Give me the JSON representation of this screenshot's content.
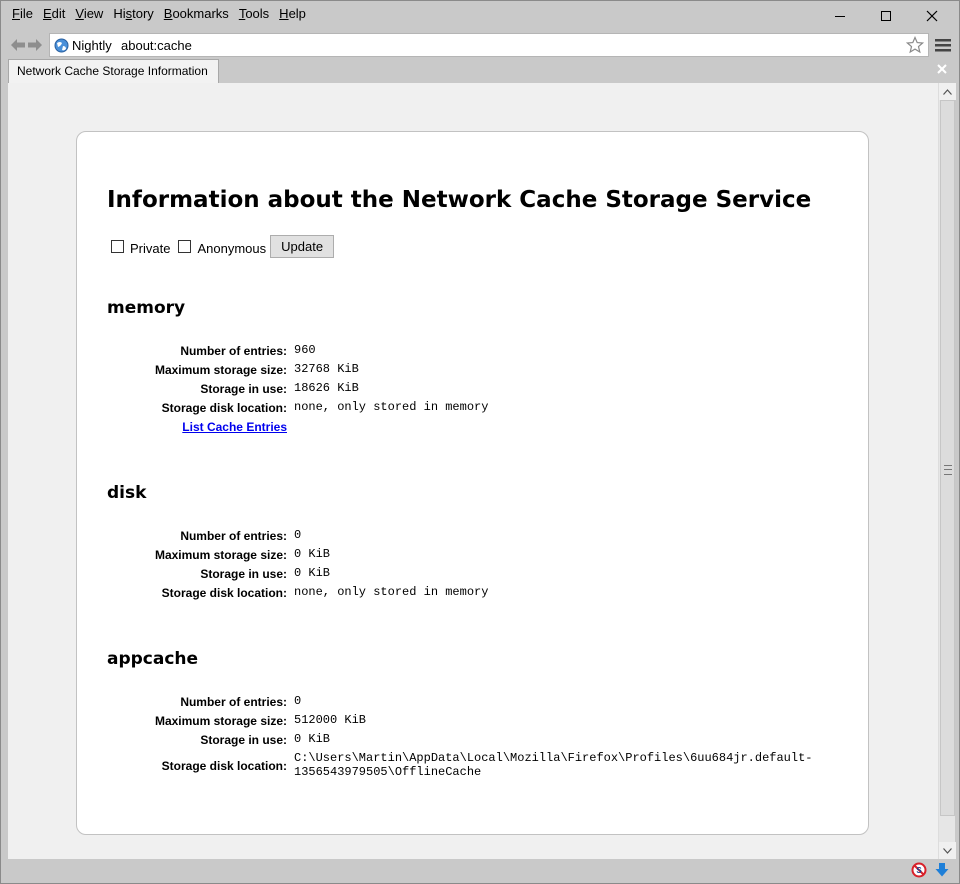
{
  "menu": {
    "items": [
      {
        "acc": "F",
        "rest": "ile"
      },
      {
        "acc": "E",
        "rest": "dit"
      },
      {
        "acc": "V",
        "rest": "iew"
      },
      {
        "pre": "Hi",
        "acc": "s",
        "rest": "tory"
      },
      {
        "acc": "B",
        "rest": "ookmarks"
      },
      {
        "acc": "T",
        "rest": "ools"
      },
      {
        "acc": "H",
        "rest": "elp"
      }
    ]
  },
  "nav": {
    "identity_label": "Nightly",
    "url": "about:cache"
  },
  "tab": {
    "title": "Network Cache Storage Information"
  },
  "page": {
    "title": "Information about the Network Cache Storage Service",
    "private_label": "Private",
    "anonymous_label": "Anonymous",
    "update_label": "Update"
  },
  "sections": {
    "memory": {
      "title": "memory",
      "entries_label": "Number of entries:",
      "entries": "960",
      "max_label": "Maximum storage size:",
      "max": "32768 KiB",
      "inuse_label": "Storage in use:",
      "inuse": "18626 KiB",
      "location_label": "Storage disk location:",
      "location": "none, only stored in memory",
      "list_link": "List Cache Entries"
    },
    "disk": {
      "title": "disk",
      "entries_label": "Number of entries:",
      "entries": "0",
      "max_label": "Maximum storage size:",
      "max": "0 KiB",
      "inuse_label": "Storage in use:",
      "inuse": "0 KiB",
      "location_label": "Storage disk location:",
      "location": "none, only stored in memory"
    },
    "appcache": {
      "title": "appcache",
      "entries_label": "Number of entries:",
      "entries": "0",
      "max_label": "Maximum storage size:",
      "max": "512000 KiB",
      "inuse_label": "Storage in use:",
      "inuse": "0 KiB",
      "location_label": "Storage disk location:",
      "location_line1": "C:\\Users\\Martin\\AppData\\Local\\Mozilla\\Firefox\\Profiles\\6uu684jr.default-",
      "location_line2": "1356543979505\\OfflineCache"
    }
  },
  "icons": {
    "back": "back-arrow-icon",
    "forward": "forward-arrow-icon",
    "globe": "globe-icon",
    "star": "bookmark-star-icon",
    "menu": "hamburger-menu-icon",
    "blocked": "blocked-icon",
    "download": "download-arrow-icon"
  },
  "colors": {
    "chrome": "#c9c9c9",
    "content_bg": "#f0f0f0",
    "link": "#0000ee",
    "download_icon": "#1e7fd8",
    "blocked_icon": "#d8202a"
  }
}
